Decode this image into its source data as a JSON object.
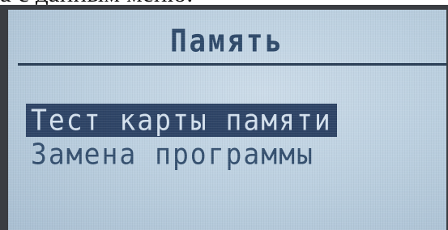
{
  "page_caption_fragment": "а с данным меню:",
  "screen": {
    "title": "Память",
    "menu_items": [
      {
        "label": "Тест карты памяти",
        "selected": true
      },
      {
        "label": "Замена программы",
        "selected": false
      }
    ]
  },
  "colors": {
    "lcd_background": "#bcd0e0",
    "text": "#35506f",
    "selection_background": "#2e4466",
    "selection_text": "#d4e1ee"
  }
}
